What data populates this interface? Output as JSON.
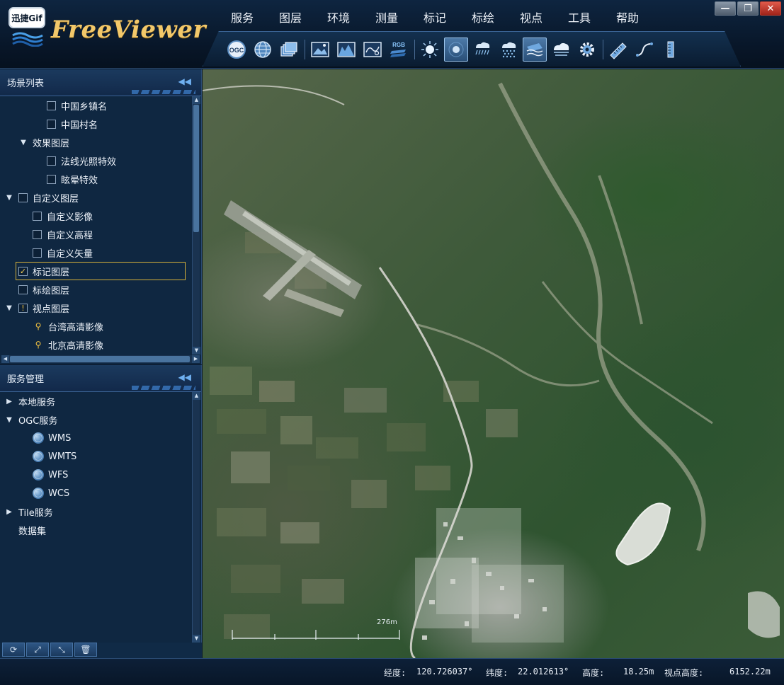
{
  "app": {
    "title": "FreeViewer",
    "badge": "迅捷Gif"
  },
  "menu": [
    "服务",
    "图层",
    "环境",
    "测量",
    "标记",
    "标绘",
    "视点",
    "工具",
    "帮助"
  ],
  "window_controls": {
    "minimize": "—",
    "restore": "❐",
    "close": "✕"
  },
  "toolbar": {
    "ogc_label": "OGC",
    "rgb_label": "RGB",
    "buttons": [
      "ogc-icon",
      "globe-icon",
      "layers-icon",
      "image-icon",
      "terrain-icon",
      "vector-map-icon",
      "rgb-icon",
      "sun-icon",
      "atmosphere-icon",
      "rain-icon",
      "snow-icon",
      "water-icon",
      "cloud-icon",
      "settings-icon",
      "ruler-icon",
      "path-measure-icon",
      "height-measure-icon"
    ]
  },
  "scene_panel": {
    "title": "场景列表",
    "items": [
      {
        "label": "中国乡镇名"
      },
      {
        "label": "中国村名"
      },
      {
        "label": "效果图层"
      },
      {
        "label": "法线光照特效"
      },
      {
        "label": "眩晕特效"
      },
      {
        "label": "自定义图层"
      },
      {
        "label": "自定义影像"
      },
      {
        "label": "自定义高程"
      },
      {
        "label": "自定义矢量"
      },
      {
        "label": "标记图层",
        "checked": true
      },
      {
        "label": "标绘图层"
      },
      {
        "label": "视点图层"
      },
      {
        "label": "台湾高清影像"
      },
      {
        "label": "北京高清影像"
      }
    ]
  },
  "service_panel": {
    "title": "服务管理",
    "items": [
      {
        "label": "本地服务"
      },
      {
        "label": "OGC服务"
      },
      {
        "label": "WMS"
      },
      {
        "label": "WMTS"
      },
      {
        "label": "WFS"
      },
      {
        "label": "WCS"
      },
      {
        "label": "Tile服务"
      },
      {
        "label": "数据集"
      }
    ]
  },
  "panel_tools": [
    "refresh-icon",
    "expand-icon",
    "collapse-icon",
    "delete-icon"
  ],
  "map": {
    "scale_label": "276m"
  },
  "status": {
    "lon_label": "经度:",
    "lon_value": "120.726037°",
    "lat_label": "纬度:",
    "lat_value": "22.012613°",
    "height_label": "高度:",
    "height_value": "18.25m",
    "view_height_label": "视点高度:",
    "view_height_value": "6152.22m"
  },
  "colors": {
    "accent": "#f2c86a",
    "selection_border": "#d7b13a",
    "panel_bg": "#0f2741",
    "toolbar_active": "#4d7aa8"
  }
}
